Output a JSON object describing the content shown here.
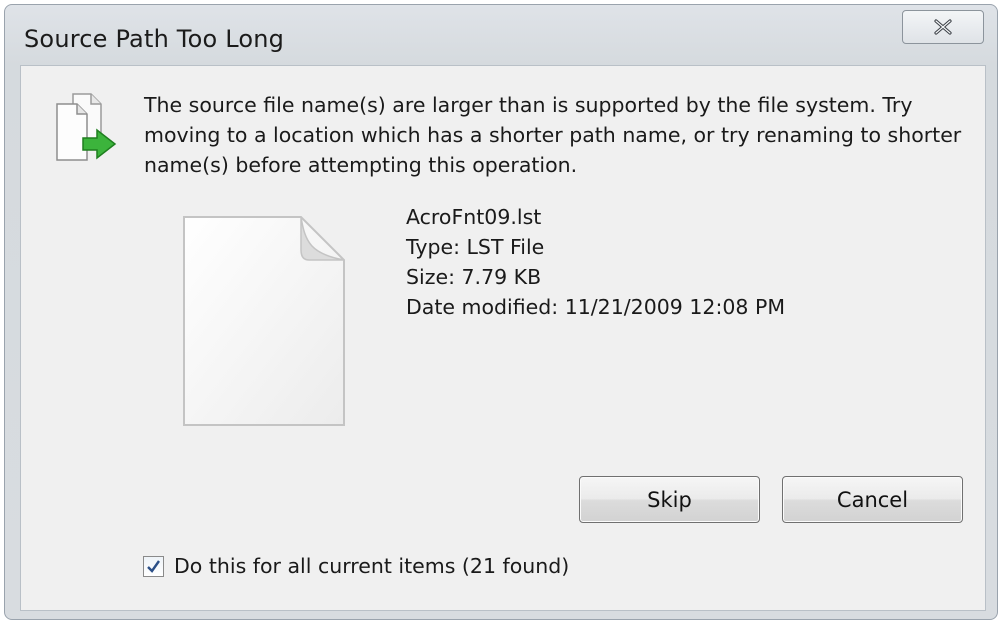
{
  "dialog": {
    "title": "Source Path Too Long",
    "message": "The source file name(s) are larger than is supported by the file system. Try moving to a location which has a shorter path name, or try renaming to shorter name(s) before attempting this operation.",
    "icons": {
      "dialog": "copy-files-icon",
      "close": "close-icon",
      "file": "generic-file-icon",
      "check": "checkmark-icon"
    }
  },
  "file": {
    "name": "AcroFnt09.lst",
    "type": "Type: LST File",
    "size": "Size: 7.79 KB",
    "date_modified": "Date modified: 11/21/2009 12:08 PM"
  },
  "buttons": {
    "skip": "Skip",
    "cancel": "Cancel"
  },
  "checkbox": {
    "label": "Do this for all current items (21 found)",
    "checked": true
  },
  "colors": {
    "window_frame": "#d8dce0",
    "client_bg": "#f0f0f0",
    "arrow_green": "#3cb43c"
  }
}
